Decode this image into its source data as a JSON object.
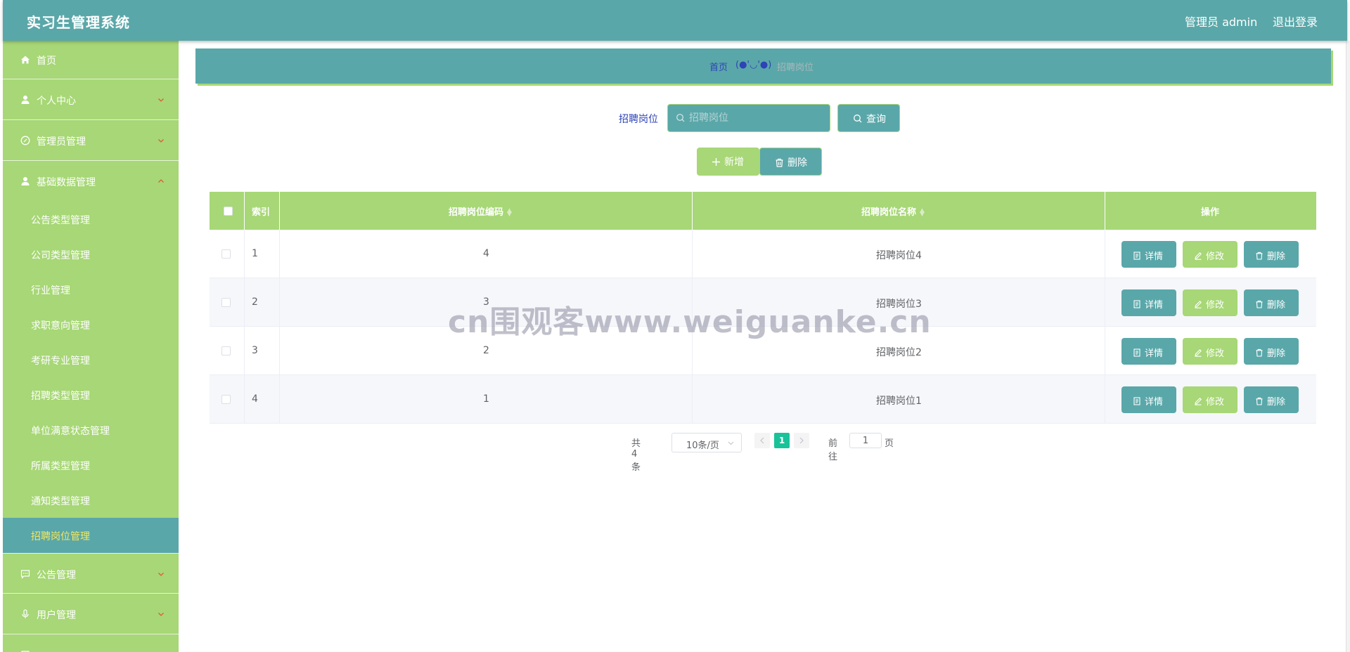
{
  "header": {
    "app_title": "实习生管理系统",
    "user": "管理员 admin",
    "logout": "退出登录"
  },
  "sidebar": {
    "items": [
      {
        "label": "首页",
        "icon": "home-icon"
      },
      {
        "label": "个人中心",
        "icon": "user-icon"
      },
      {
        "label": "管理员管理",
        "icon": "compass-icon"
      },
      {
        "label": "基础数据管理",
        "icon": "user-icon",
        "expanded": true
      },
      {
        "label": "公告管理",
        "icon": "chat-icon"
      },
      {
        "label": "用户管理",
        "icon": "microphone-icon"
      }
    ],
    "sub_items": [
      {
        "label": "公告类型管理"
      },
      {
        "label": "公司类型管理"
      },
      {
        "label": "行业管理"
      },
      {
        "label": "求职意向管理"
      },
      {
        "label": "考研专业管理"
      },
      {
        "label": "招聘类型管理"
      },
      {
        "label": "单位满意状态管理"
      },
      {
        "label": "所属类型管理"
      },
      {
        "label": "通知类型管理"
      },
      {
        "label": "招聘岗位管理",
        "active": true
      }
    ]
  },
  "breadcrumb": {
    "home": "首页",
    "separator": "(●'◡'●)",
    "current": "招聘岗位"
  },
  "search": {
    "label": "招聘岗位",
    "placeholder": "招聘岗位",
    "query_button": "查询"
  },
  "actions": {
    "add_button": "新增",
    "delete_button": "删除"
  },
  "table": {
    "columns": [
      "索引",
      "招聘岗位编码",
      "招聘岗位名称",
      "操作"
    ],
    "rows": [
      {
        "index": "1",
        "code": "4",
        "name": "招聘岗位4"
      },
      {
        "index": "2",
        "code": "3",
        "name": "招聘岗位3"
      },
      {
        "index": "3",
        "code": "2",
        "name": "招聘岗位2"
      },
      {
        "index": "4",
        "code": "1",
        "name": "招聘岗位1"
      }
    ],
    "row_actions": {
      "detail": "详情",
      "edit": "修改",
      "delete": "删除"
    }
  },
  "pagination": {
    "total_text": "共 4 条",
    "page_size": "10条/页",
    "current_page": "1",
    "goto_label": "前往",
    "goto_value": "1",
    "page_unit": "页"
  },
  "watermark": "cn围观客www.weiguanke.cn",
  "colors": {
    "primary_teal": "#5aa7a9",
    "accent_green": "#a7d776",
    "active_text": "#f5e85b",
    "page_active": "#1ac29a"
  }
}
